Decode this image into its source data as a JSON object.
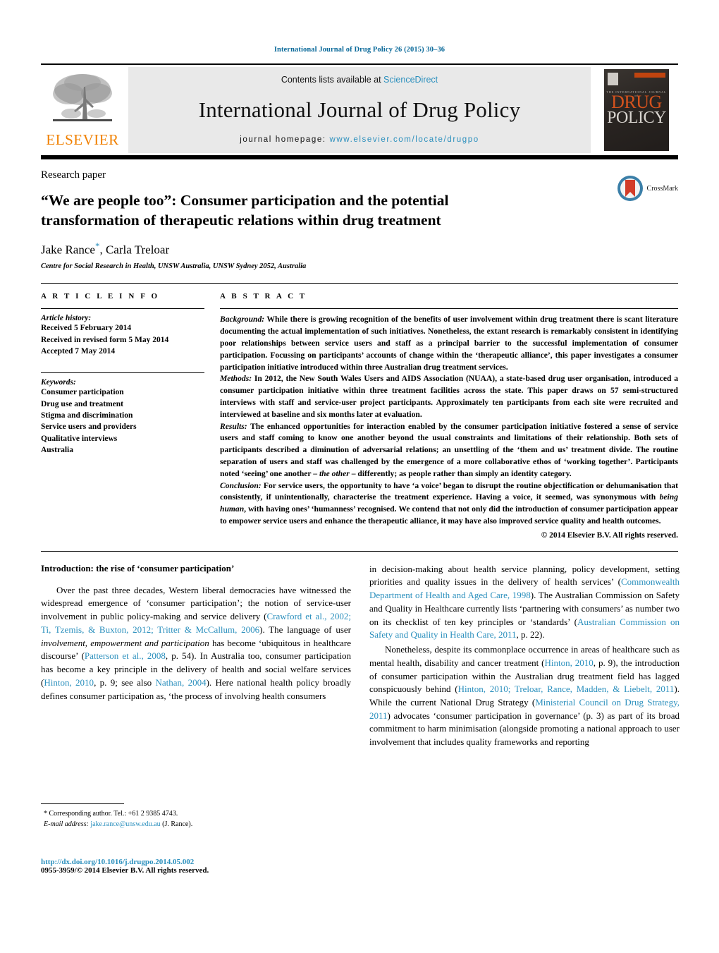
{
  "running_head": "International Journal of Drug Policy 26 (2015) 30–36",
  "masthead": {
    "elsevier_wordmark": "ELSEVIER",
    "contents_prefix": "Contents lists available at ",
    "contents_link": "ScienceDirect",
    "journal_title": "International Journal of Drug Policy",
    "homepage_prefix": "journal homepage: ",
    "homepage_url": "www.elsevier.com/locate/drugpo",
    "cover": {
      "kicker": "THE INTERNATIONAL JOURNAL of",
      "line1": "DRUG",
      "line2": "POLICY"
    },
    "colors": {
      "elsevier_orange": "#f08000",
      "link_blue": "#2a8fbd",
      "band_grey": "#e9e9e9",
      "cover_orange": "#d4521d"
    }
  },
  "article": {
    "kicker": "Research paper",
    "title": "“We are people too”: Consumer participation and the potential transformation of therapeutic relations within drug treatment",
    "authors": "Jake Rance*, Carla Treloar",
    "author_one": "Jake Rance",
    "author_two": ", Carla Treloar",
    "corresponding_marker": "*",
    "affiliation": "Centre for Social Research in Health, UNSW Australia, UNSW Sydney 2052, Australia",
    "crossmark_label": "CrossMark"
  },
  "article_info": {
    "heading": "A R T I C L E   I N F O",
    "history_label": "Article history:",
    "history": [
      "Received 5 February 2014",
      "Received in revised form 5 May 2014",
      "Accepted 7 May 2014"
    ],
    "keywords_label": "Keywords:",
    "keywords": [
      "Consumer participation",
      "Drug use and treatment",
      "Stigma and discrimination",
      "Service users and providers",
      "Qualitative interviews",
      "Australia"
    ]
  },
  "abstract": {
    "heading": "A B S T R A C T",
    "background_label": "Background:",
    "background_text": " While there is growing recognition of the benefits of user involvement within drug treatment there is scant literature documenting the actual implementation of such initiatives. Nonetheless, the extant research is remarkably consistent in identifying poor relationships between service users and staff as a principal barrier to the successful implementation of consumer participation. Focussing on participants’ accounts of change within the ‘therapeutic alliance’, this paper investigates a consumer participation initiative introduced within three Australian drug treatment services.",
    "methods_label": "Methods:",
    "methods_text": " In 2012, the New South Wales Users and AIDS Association (NUAA), a state-based drug user organisation, introduced a consumer participation initiative within three treatment facilities across the state. This paper draws on 57 semi-structured interviews with staff and service-user project participants. Approximately ten participants from each site were recruited and interviewed at baseline and six months later at evaluation.",
    "results_label": "Results:",
    "results_text_a": " The enhanced opportunities for interaction enabled by the consumer participation initiative fostered a sense of service users and staff coming to know one another beyond the usual constraints and limitations of their relationship. Both sets of participants described a diminution of adversarial relations; an unsettling of the ‘them and us’ treatment divide. The routine separation of users and staff was challenged by the emergence of a more collaborative ethos of ‘working together’. Participants noted ‘seeing’ one another – ",
    "results_italic": "the other",
    "results_text_b": " – differently; as people rather than simply an identity category.",
    "conclusion_label": "Conclusion:",
    "conclusion_text_a": " For service users, the opportunity to have ‘a voice’ began to disrupt the routine objectification or dehumanisation that consistently, if unintentionally, characterise the treatment experience. Having a voice, it seemed, was synonymous with ",
    "conclusion_italic": "being human",
    "conclusion_text_b": ", with having ones’ ‘humanness’ recognised. We contend that not only did the introduction of consumer participation appear to empower service users and enhance the therapeutic alliance, it may have also improved service quality and health outcomes.",
    "copyright": "© 2014 Elsevier B.V. All rights reserved."
  },
  "body": {
    "intro_heading": "Introduction: the rise of ‘consumer participation’",
    "left_p1_a": "Over the past three decades, Western liberal democracies have witnessed the widespread emergence of ‘consumer participation’; the notion of service-user involvement in public policy-making and service delivery (",
    "left_cite1": "Crawford et al., 2002; Ti, Tzemis, & Buxton, 2012; Tritter & McCallum, 2006",
    "left_p1_b": "). The language of user ",
    "left_p1_italic1": "involvement, empowerment and participation",
    "left_p1_c": " has become ‘ubiquitous in healthcare discourse’ (",
    "left_cite2": "Patterson et al., 2008",
    "left_p1_d": ", p. 54). In Australia too, consumer participation has become a key principle in the delivery of health and social welfare services (",
    "left_cite3": "Hinton, 2010",
    "left_p1_e": ", p. 9; see also ",
    "left_cite4": "Nathan, 2004",
    "left_p1_f": "). Here national health policy broadly defines consumer participation as, ‘the process of involving health consumers",
    "right_p1_a": "in decision-making about health service planning, policy development, setting priorities and quality issues in the delivery of health services’ (",
    "right_cite1": "Commonwealth Department of Health and Aged Care, 1998",
    "right_p1_b": "). The Australian Commission on Safety and Quality in Healthcare currently lists ‘partnering with consumers’ as number two on its checklist of ten key principles or ‘standards’ (",
    "right_cite2": "Australian Commission on Safety and Quality in Health Care, 2011",
    "right_p1_c": ", p. 22).",
    "right_p2_a": "Nonetheless, despite its commonplace occurrence in areas of healthcare such as mental health, disability and cancer treatment (",
    "right_cite3": "Hinton, 2010",
    "right_p2_b": ", p. 9), the introduction of consumer participation within the Australian drug treatment field has lagged conspicuously behind (",
    "right_cite4": "Hinton, 2010; Treloar, Rance, Madden, & Liebelt, 2011",
    "right_p2_c": "). While the current National Drug Strategy (",
    "right_cite5": "Ministerial Council on Drug Strategy, 2011",
    "right_p2_d": ") advocates ‘consumer participation in governance’ (p. 3) as part of its broad commitment to harm minimisation (alongside promoting a national approach to user involvement that includes quality frameworks and reporting"
  },
  "footnote": {
    "marker": "*",
    "corresponding": " Corresponding author. Tel.: +61 2 9385 4743.",
    "email_label": "E-mail address:",
    "email": "jake.rance@unsw.edu.au",
    "email_suffix": " (J. Rance).",
    "doi": "http://dx.doi.org/10.1016/j.drugpo.2014.05.002",
    "issn": "0955-3959/© 2014 Elsevier B.V. All rights reserved."
  }
}
